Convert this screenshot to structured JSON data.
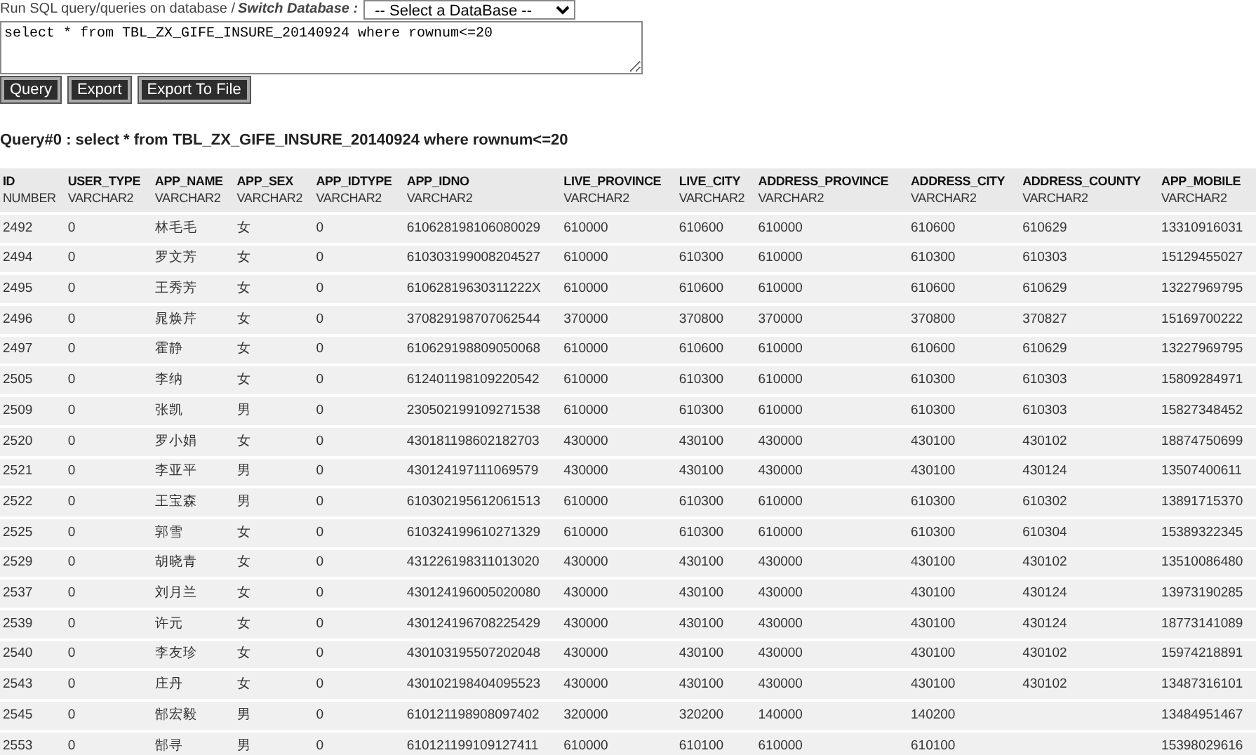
{
  "header": {
    "label": "Run SQL query/queries on database / ",
    "switch_label": "Switch Database :",
    "database_select": {
      "value": "-- Select a DataBase --"
    }
  },
  "query_box": {
    "value": "select * from TBL_ZX_GIFE_INSURE_20140924 where rownum<=20"
  },
  "buttons": [
    "Query",
    "Export",
    "Export To File"
  ],
  "result_title": "Query#0 : select * from TBL_ZX_GIFE_INSURE_20140924 where rownum<=20",
  "table": {
    "columns": [
      {
        "name": "ID",
        "type": "NUMBER"
      },
      {
        "name": "USER_TYPE",
        "type": "VARCHAR2"
      },
      {
        "name": "APP_NAME",
        "type": "VARCHAR2"
      },
      {
        "name": "APP_SEX",
        "type": "VARCHAR2"
      },
      {
        "name": "APP_IDTYPE",
        "type": "VARCHAR2"
      },
      {
        "name": "APP_IDNO",
        "type": "VARCHAR2"
      },
      {
        "name": "LIVE_PROVINCE",
        "type": "VARCHAR2"
      },
      {
        "name": "LIVE_CITY",
        "type": "VARCHAR2"
      },
      {
        "name": "ADDRESS_PROVINCE",
        "type": "VARCHAR2"
      },
      {
        "name": "ADDRESS_CITY",
        "type": "VARCHAR2"
      },
      {
        "name": "ADDRESS_COUNTY",
        "type": "VARCHAR2"
      },
      {
        "name": "APP_MOBILE",
        "type": "VARCHAR2"
      }
    ],
    "rows": [
      [
        "2492",
        "0",
        "林毛毛",
        "女",
        "0",
        "610628198106080029",
        "610000",
        "610600",
        "610000",
        "610600",
        "610629",
        "13310916031"
      ],
      [
        "2494",
        "0",
        "罗文芳",
        "女",
        "0",
        "610303199008204527",
        "610000",
        "610300",
        "610000",
        "610300",
        "610303",
        "15129455027"
      ],
      [
        "2495",
        "0",
        "王秀芳",
        "女",
        "0",
        "61062819630311222X",
        "610000",
        "610600",
        "610000",
        "610600",
        "610629",
        "13227969795"
      ],
      [
        "2496",
        "0",
        "晁焕芹",
        "女",
        "0",
        "370829198707062544",
        "370000",
        "370800",
        "370000",
        "370800",
        "370827",
        "15169700222"
      ],
      [
        "2497",
        "0",
        "霍静",
        "女",
        "0",
        "610629198809050068",
        "610000",
        "610600",
        "610000",
        "610600",
        "610629",
        "13227969795"
      ],
      [
        "2505",
        "0",
        "李纳",
        "女",
        "0",
        "612401198109220542",
        "610000",
        "610300",
        "610000",
        "610300",
        "610303",
        "15809284971"
      ],
      [
        "2509",
        "0",
        "张凯",
        "男",
        "0",
        "230502199109271538",
        "610000",
        "610300",
        "610000",
        "610300",
        "610303",
        "15827348452"
      ],
      [
        "2520",
        "0",
        "罗小娟",
        "女",
        "0",
        "430181198602182703",
        "430000",
        "430100",
        "430000",
        "430100",
        "430102",
        "18874750699"
      ],
      [
        "2521",
        "0",
        "李亚平",
        "男",
        "0",
        "430124197111069579",
        "430000",
        "430100",
        "430000",
        "430100",
        "430124",
        "13507400611"
      ],
      [
        "2522",
        "0",
        "王宝森",
        "男",
        "0",
        "610302195612061513",
        "610000",
        "610300",
        "610000",
        "610300",
        "610302",
        "13891715370"
      ],
      [
        "2525",
        "0",
        "郭雪",
        "女",
        "0",
        "610324199610271329",
        "610000",
        "610300",
        "610000",
        "610300",
        "610304",
        "15389322345"
      ],
      [
        "2529",
        "0",
        "胡晓青",
        "女",
        "0",
        "431226198311013020",
        "430000",
        "430100",
        "430000",
        "430100",
        "430102",
        "13510086480"
      ],
      [
        "2537",
        "0",
        "刘月兰",
        "女",
        "0",
        "430124196005020080",
        "430000",
        "430100",
        "430000",
        "430100",
        "430124",
        "13973190285"
      ],
      [
        "2539",
        "0",
        "许元",
        "女",
        "0",
        "430124196708225429",
        "430000",
        "430100",
        "430000",
        "430100",
        "430124",
        "18773141089"
      ],
      [
        "2540",
        "0",
        "李友珍",
        "女",
        "0",
        "430103195507202048",
        "430000",
        "430100",
        "430000",
        "430100",
        "430102",
        "15974218891"
      ],
      [
        "2543",
        "0",
        "庄丹",
        "女",
        "0",
        "430102198404095523",
        "430000",
        "430100",
        "430000",
        "430100",
        "430102",
        "13487316101"
      ],
      [
        "2545",
        "0",
        "郜宏毅",
        "男",
        "0",
        "610121198908097402",
        "320000",
        "320200",
        "140000",
        "140200",
        null,
        "13484951467"
      ],
      [
        "2553",
        "0",
        "郜寻",
        "男",
        "0",
        "610121199109127411",
        "610000",
        "610100",
        "610000",
        "610100",
        null,
        "15398029616"
      ]
    ]
  }
}
